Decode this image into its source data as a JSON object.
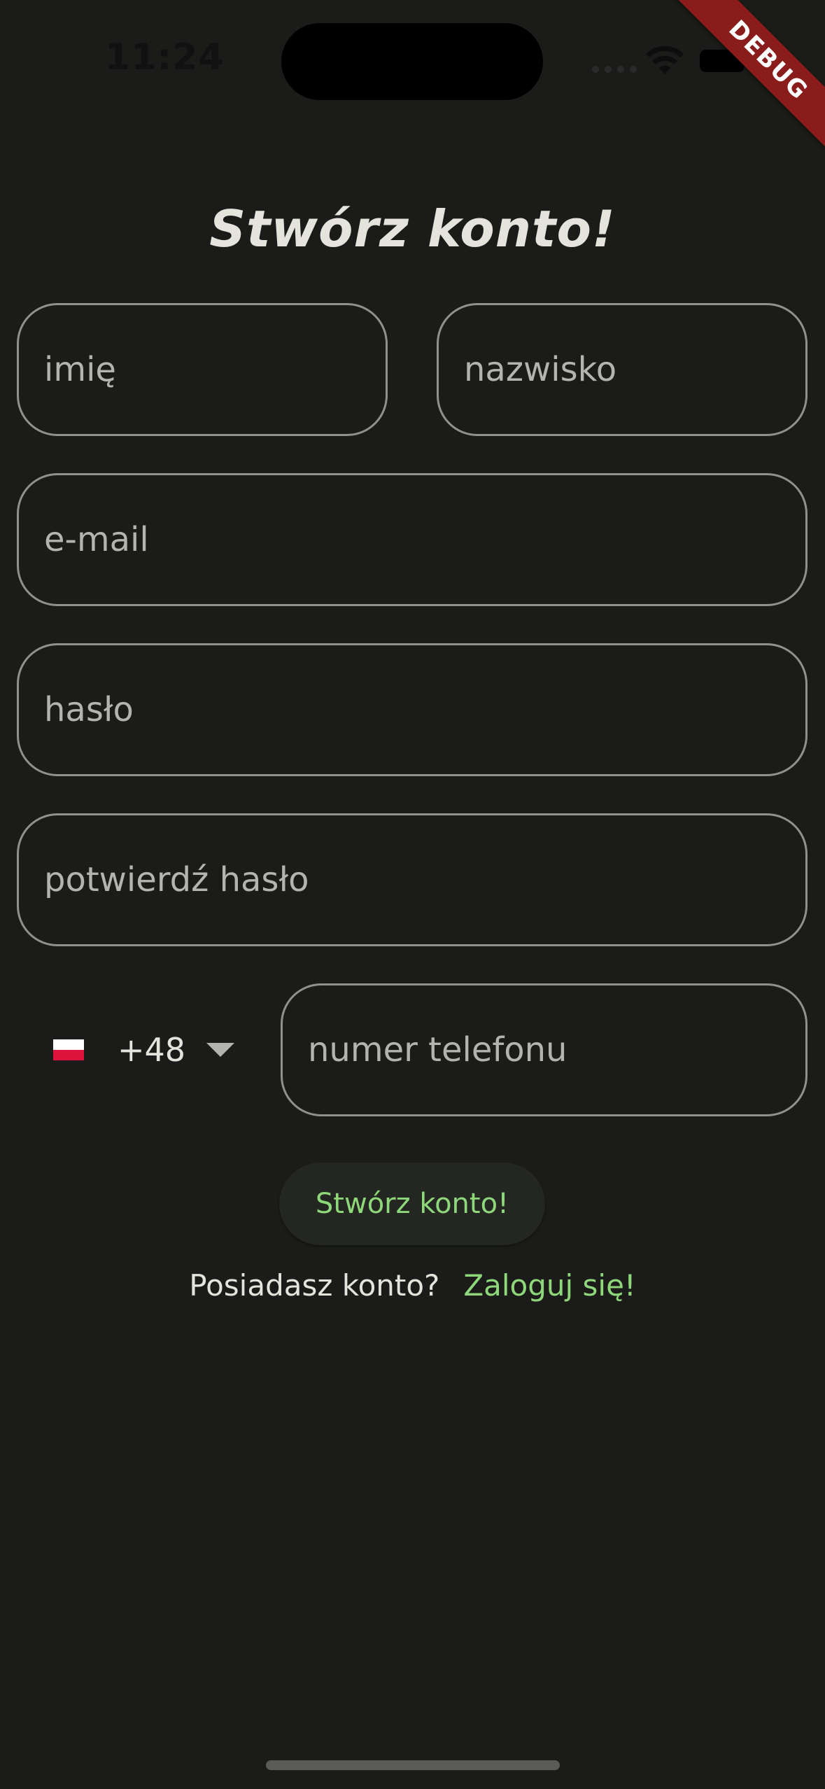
{
  "status_bar": {
    "time": "11:24"
  },
  "debug_banner": "DEBUG",
  "title": "Stwórz konto!",
  "form": {
    "first_name_placeholder": "imię",
    "last_name_placeholder": "nazwisko",
    "email_placeholder": "e-mail",
    "password_placeholder": "hasło",
    "confirm_password_placeholder": "potwierdź hasło",
    "phone": {
      "country_flag": "poland-flag-icon",
      "dial_code": "+48",
      "placeholder": "numer telefonu"
    },
    "submit_label": "Stwórz konto!"
  },
  "login_prompt": {
    "question": "Posiadasz konto?",
    "link_label": "Zaloguj się!"
  },
  "colors": {
    "background": "#1b1c19",
    "accent": "#8ed77a",
    "text": "#e4e3dc",
    "border": "#8f918b",
    "debug": "#8b1c1c"
  }
}
